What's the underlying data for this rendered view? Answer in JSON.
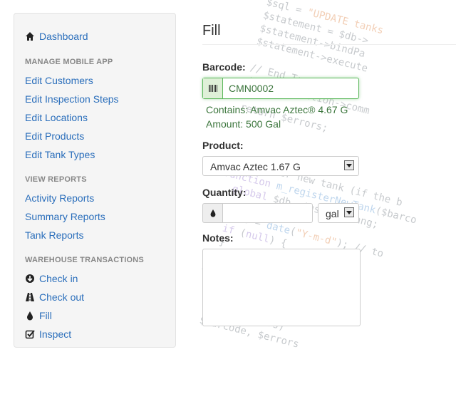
{
  "sidebar": {
    "dashboard": "Dashboard",
    "sections": [
      {
        "header": "MANAGE MOBILE APP",
        "items": [
          "Edit Customers",
          "Edit Inspection Steps",
          "Edit Locations",
          "Edit Products",
          "Edit Tank Types"
        ]
      },
      {
        "header": "VIEW REPORTS",
        "items": [
          "Activity Reports",
          "Summary Reports",
          "Tank Reports"
        ]
      },
      {
        "header": "WAREHOUSE TRANSACTIONS",
        "items": [
          "Check in",
          "Check out",
          "Fill",
          "Inspect"
        ]
      }
    ]
  },
  "form": {
    "title": "Fill",
    "barcode_label": "Barcode:",
    "barcode_value": "CMN0002",
    "contains_text": "Contains: Amvac Aztec® 4.67 G",
    "amount_text": "Amount: 500 Gal",
    "product_label": "Product:",
    "product_selected": "Amvac Aztec 1.67 G",
    "quantity_label": "Quantity:",
    "quantity_value": "",
    "unit_selected": "gal",
    "notes_label": "Notes:",
    "notes_value": ""
  },
  "icons": {
    "dashboard": "home-icon",
    "check_in": "arrow-circle-down-icon",
    "check_out": "road-icon",
    "fill": "drop-icon",
    "inspect": "check-square-icon",
    "barcode": "barcode-icon",
    "quantity": "drop-icon"
  },
  "colors": {
    "link": "#2a6ebb",
    "success": "#3c763d",
    "success_border": "#5cb85c"
  }
}
